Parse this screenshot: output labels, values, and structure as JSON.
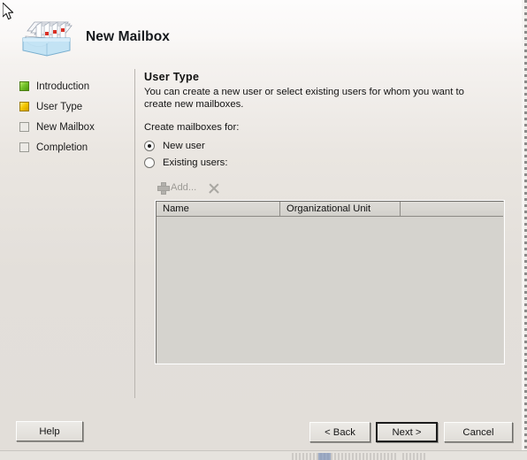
{
  "window": {
    "title": "New Mailbox",
    "icon": "mailbox-card-file-icon"
  },
  "sidebar": {
    "items": [
      {
        "label": "Introduction",
        "state": "done",
        "icon": "step-complete-icon"
      },
      {
        "label": "User Type",
        "state": "current",
        "icon": "step-current-icon"
      },
      {
        "label": "New Mailbox",
        "state": "pending",
        "icon": "step-pending-icon"
      },
      {
        "label": "Completion",
        "state": "pending",
        "icon": "step-pending-icon"
      }
    ]
  },
  "main": {
    "section_title": "User Type",
    "description": "You can create a new user or select existing users for whom you want to create new mailboxes.",
    "group_label": "Create mailboxes for:",
    "radios": [
      {
        "label": "New user",
        "checked": true
      },
      {
        "label": "Existing users:",
        "checked": false
      }
    ],
    "toolbar": {
      "add_label": "Add...",
      "add_icon": "plus-icon",
      "remove_icon": "x-remove-icon",
      "enabled": false
    },
    "listview": {
      "columns": [
        "Name",
        "Organizational Unit",
        ""
      ],
      "rows": [],
      "enabled": false
    }
  },
  "footer": {
    "help_label": "Help",
    "back_label": "< Back",
    "next_label": "Next >",
    "cancel_label": "Cancel",
    "default_button": "next-button"
  },
  "colors": {
    "background": "#e3dfda",
    "header": "#faf8f7",
    "step_done": "#74c32a",
    "step_current": "#f5c800",
    "step_pending": "#eceae6",
    "listview_disabled": "#d5d3ce",
    "text": "#131313"
  }
}
